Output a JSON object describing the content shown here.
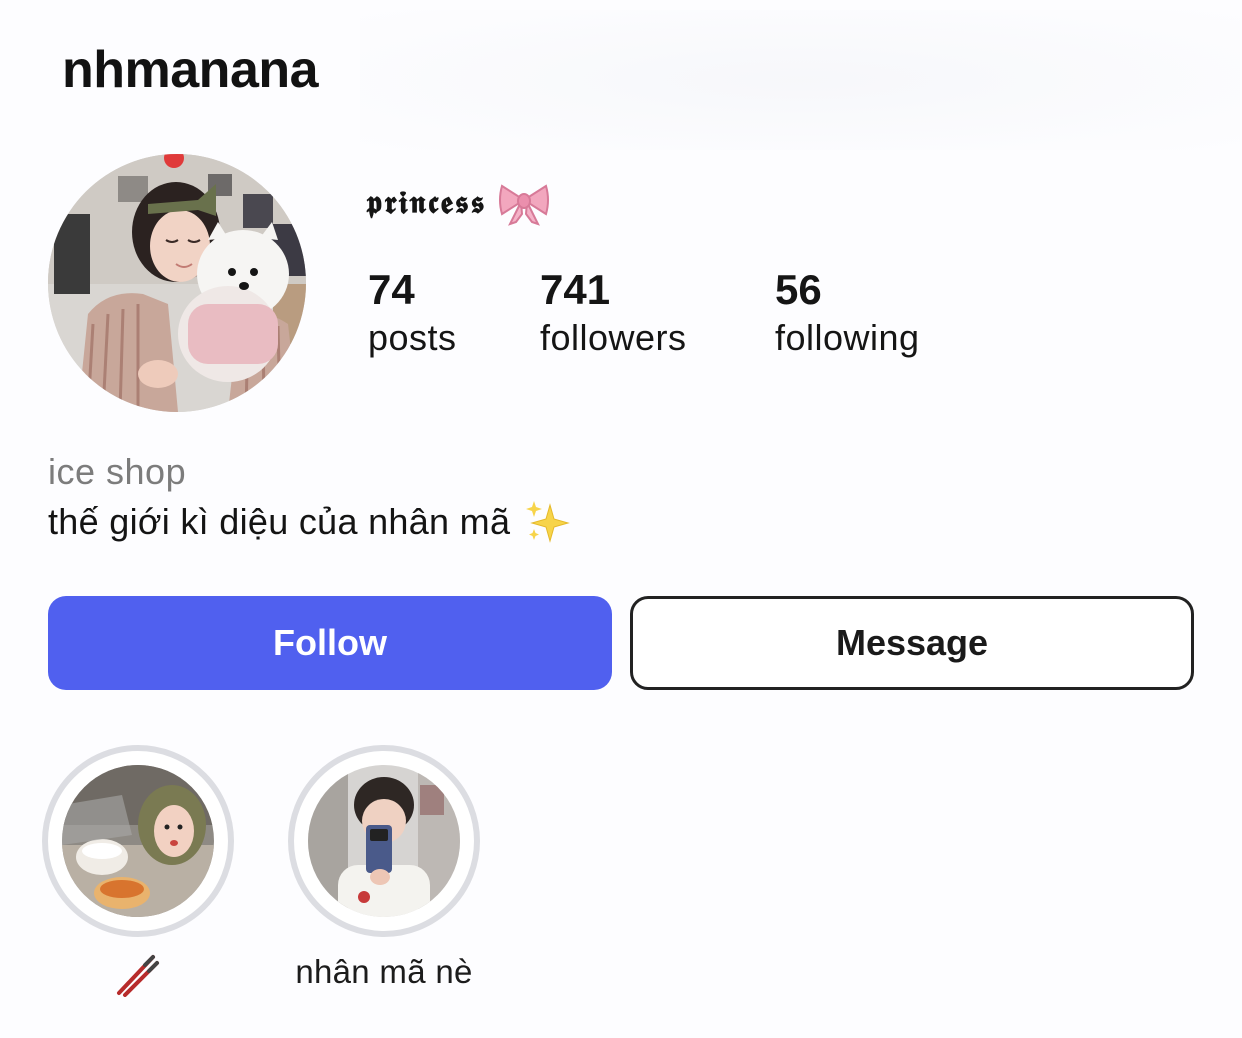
{
  "header": {
    "username": "nhmanana"
  },
  "profile": {
    "display_name": "𝖕𝖗𝖎𝖓𝖈𝖊𝖘𝖘",
    "display_name_icon": "ribbon-bow-icon",
    "avatar": "profile-photo-girl-with-white-dog",
    "stats": [
      {
        "value": "74",
        "label": "posts"
      },
      {
        "value": "741",
        "label": "followers"
      },
      {
        "value": "56",
        "label": "following"
      }
    ],
    "category": "ice shop",
    "bio": "thế giới kì diệu của nhân mã",
    "bio_icon": "sparkles-icon"
  },
  "actions": {
    "follow_label": "Follow",
    "message_label": "Message"
  },
  "highlights": [
    {
      "label_icon": "chopsticks-icon",
      "photo": "selfie-with-rice-bowls"
    },
    {
      "label": "nhân mã nè",
      "photo": "mirror-selfie-with-phone"
    }
  ],
  "colors": {
    "follow_button": "#5060ef",
    "message_border": "#222222",
    "ring": "#dcdde2",
    "category_text": "#7c7c7c"
  }
}
